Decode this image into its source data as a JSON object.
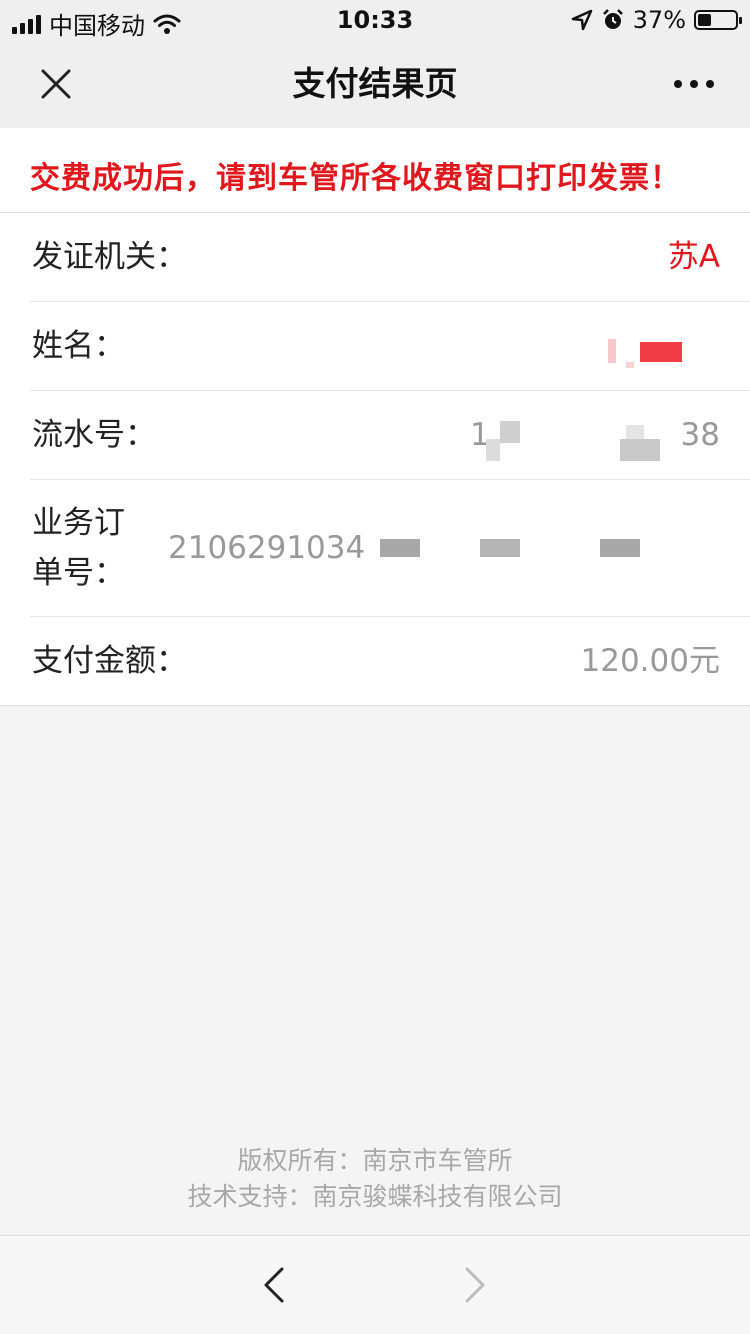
{
  "status_bar": {
    "carrier": "中国移动",
    "time": "10:33",
    "battery_text": "37%",
    "battery_level": 0.37,
    "icons": [
      "signal-icon",
      "wifi-icon",
      "location-arrow-icon",
      "alarm-clock-icon",
      "battery-icon"
    ]
  },
  "nav": {
    "title": "支付结果页",
    "close_icon": "close-icon",
    "more_icon": "more-dots-icon"
  },
  "notice": {
    "text": "交费成功后，请到车管所各收费窗口打印发票！",
    "color": "#e0181e"
  },
  "info": {
    "issuing_authority": {
      "label": "发证机关：",
      "value": "苏A"
    },
    "name": {
      "label": "姓名：",
      "value": ""
    },
    "serial_number": {
      "label": "流水号：",
      "value_start": "1",
      "value_end": "38"
    },
    "order_number": {
      "label": "业务订单号：",
      "value": "2106291034"
    },
    "amount": {
      "label": "支付金额：",
      "value": "120.00元"
    }
  },
  "footer": {
    "copyright": "版权所有：南京市车管所",
    "tech_support": "技术支持：南京骏蝶科技有限公司"
  },
  "toolbar": {
    "back_icon": "chevron-left-icon",
    "forward_icon": "chevron-right-icon",
    "forward_enabled": false
  }
}
